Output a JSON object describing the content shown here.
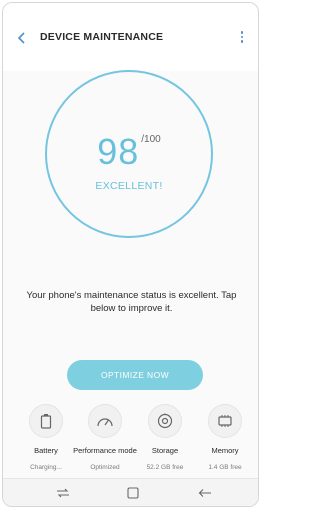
{
  "header": {
    "title": "DEVICE MAINTENANCE",
    "back_icon": "back-chevron-icon",
    "more_icon": "more-vertical-icon"
  },
  "score": {
    "value": "98",
    "max": "/100",
    "status": "EXCELLENT!",
    "ring_color": "#74c6e0"
  },
  "message": "Your phone's maintenance status is excellent. Tap below to improve it.",
  "optimize_button": "OPTIMIZE NOW",
  "items": [
    {
      "label": "Battery",
      "value": "Charging...",
      "icon": "battery-icon"
    },
    {
      "label": "Performance mode",
      "value": "Optimized",
      "icon": "speedometer-icon"
    },
    {
      "label": "Storage",
      "value": "52.2 GB free",
      "icon": "storage-disc-icon"
    },
    {
      "label": "Memory",
      "value": "1.4 GB free",
      "icon": "memory-chip-icon"
    }
  ],
  "navbar": {
    "recent_icon": "recent-apps-icon",
    "home_icon": "home-icon",
    "back_icon": "back-arrow-icon"
  }
}
